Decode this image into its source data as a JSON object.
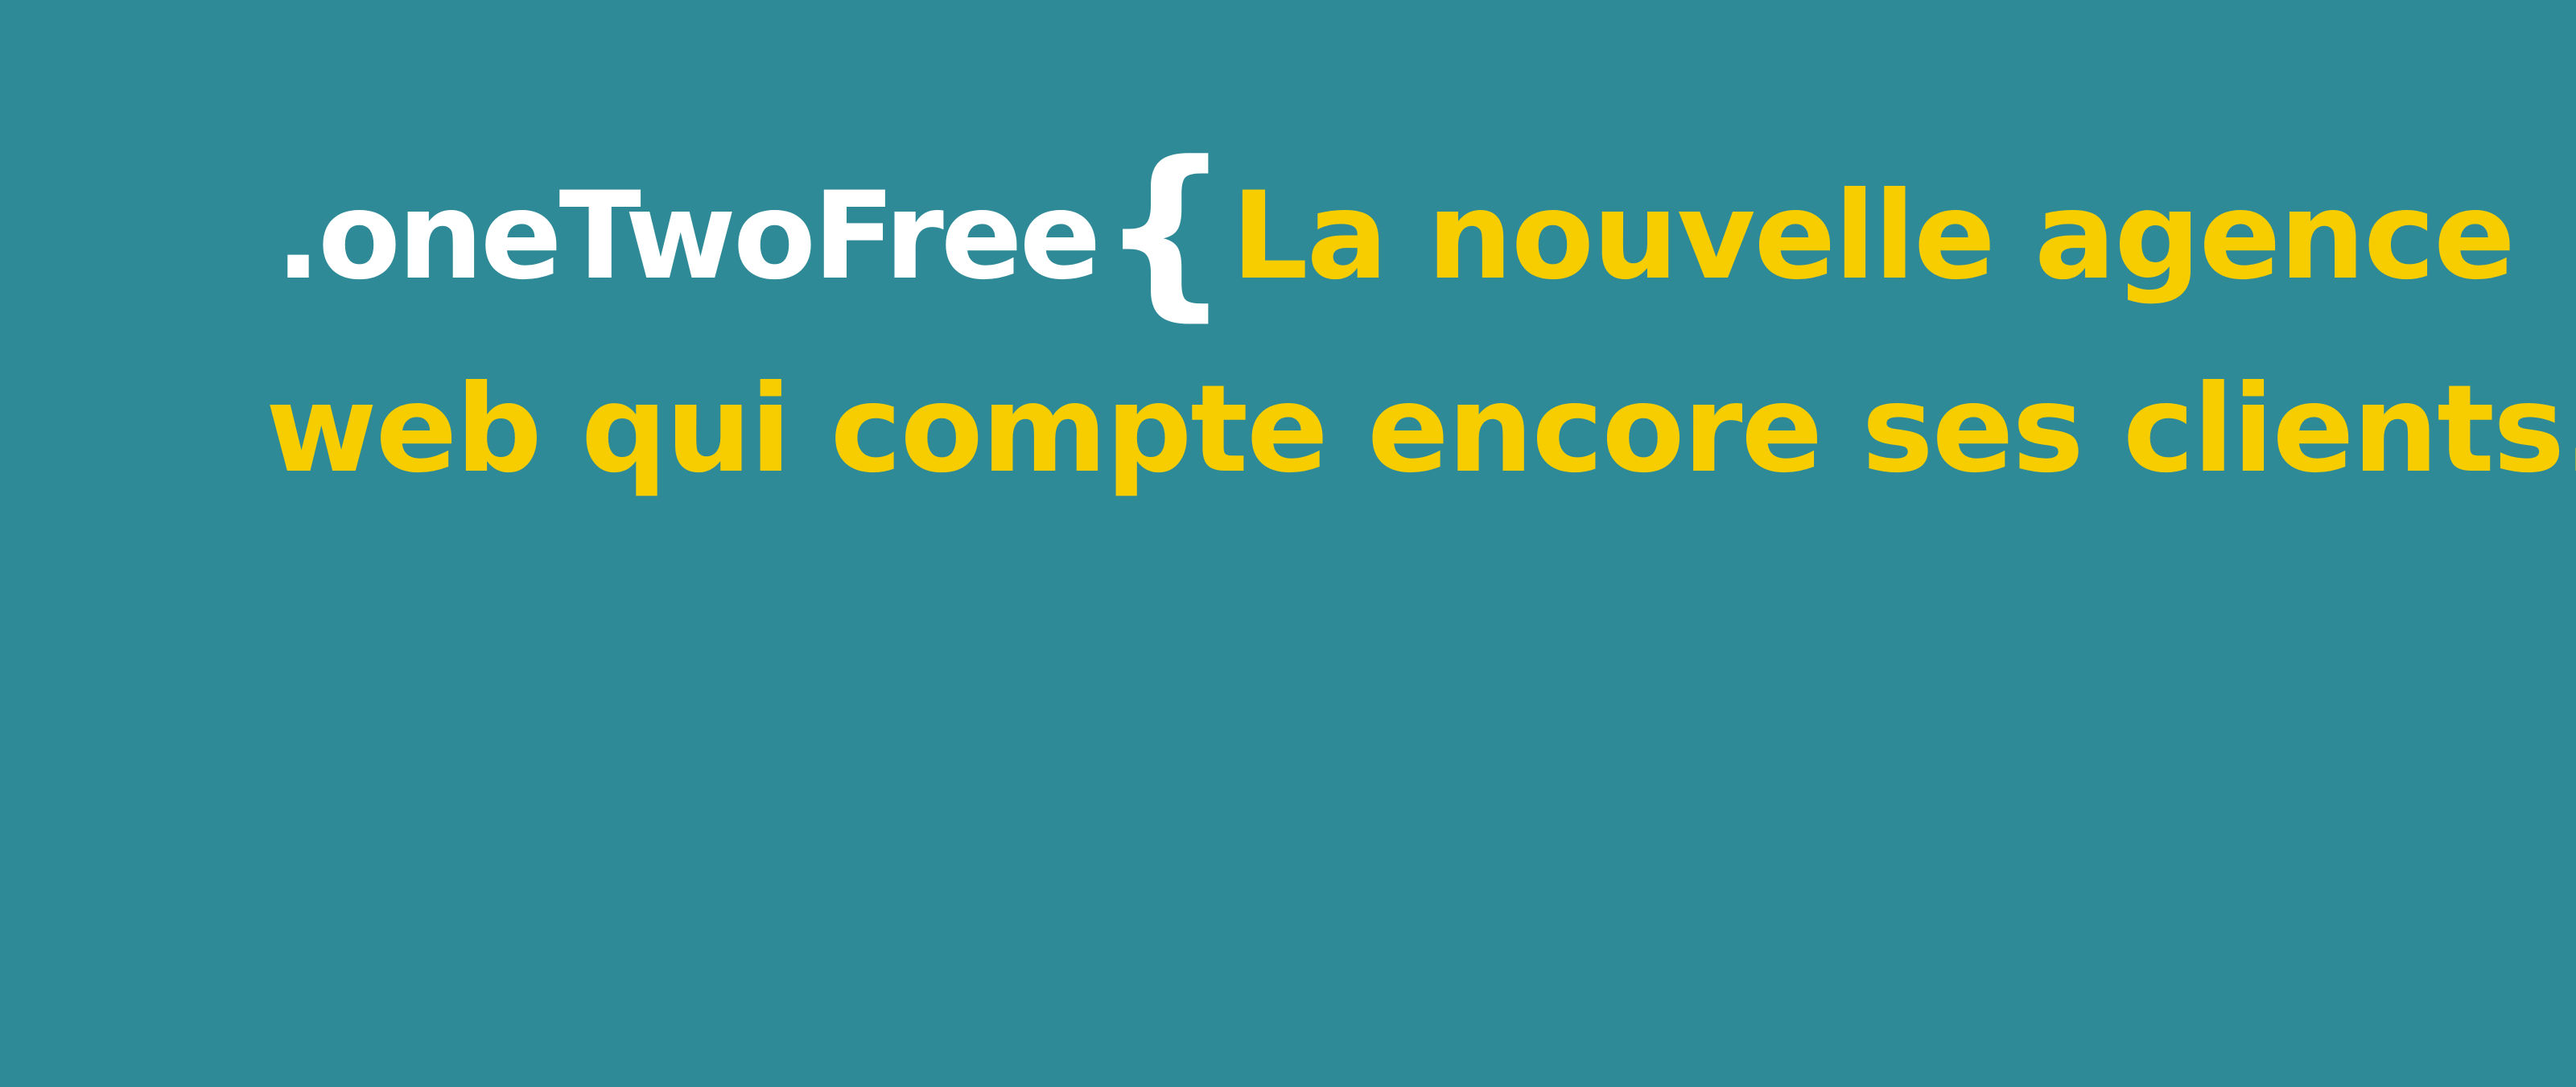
{
  "colors": {
    "background": "#2f8a97",
    "brand_text": "#ffffff",
    "tagline_text": "#f7cd00",
    "brace": "#ffffff"
  },
  "headline": {
    "brand_name": ".oneTwoFree",
    "open_brace": "{",
    "tagline_line1": "La nouvelle agence",
    "tagline_line2": "web qui compte encore ses clients.",
    "close_brace": "}"
  }
}
